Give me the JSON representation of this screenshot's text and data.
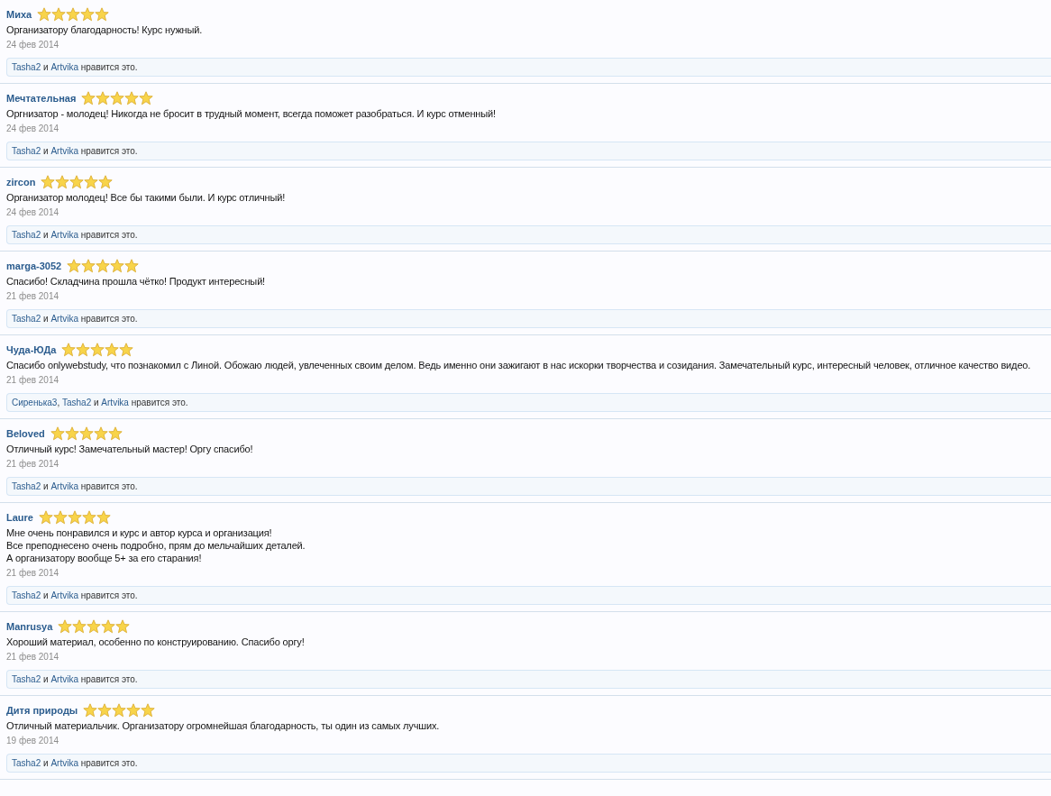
{
  "reviews": [
    {
      "author": "Миха",
      "stars": 5,
      "text": [
        "Организатору благодарность! Курс нужный."
      ],
      "date": "24 фев 2014",
      "likes": [
        {
          "kind": "link",
          "text": "Tasha2"
        },
        {
          "kind": "text",
          "text": " и "
        },
        {
          "kind": "link",
          "text": "Artvika"
        },
        {
          "kind": "text",
          "text": " нравится это."
        }
      ]
    },
    {
      "author": "Мечтательная",
      "stars": 5,
      "text": [
        "Оргнизатор - молодец! Никогда не бросит в трудный момент, всегда поможет разобраться. И курс отменный!"
      ],
      "date": "24 фев 2014",
      "likes": [
        {
          "kind": "link",
          "text": "Tasha2"
        },
        {
          "kind": "text",
          "text": " и "
        },
        {
          "kind": "link",
          "text": "Artvika"
        },
        {
          "kind": "text",
          "text": " нравится это."
        }
      ]
    },
    {
      "author": "zircon",
      "stars": 5,
      "text": [
        "Организатор молодец! Все бы такими были. И курс отличный!"
      ],
      "date": "24 фев 2014",
      "likes": [
        {
          "kind": "link",
          "text": "Tasha2"
        },
        {
          "kind": "text",
          "text": " и "
        },
        {
          "kind": "link",
          "text": "Artvika"
        },
        {
          "kind": "text",
          "text": " нравится это."
        }
      ]
    },
    {
      "author": "marga-3052",
      "stars": 5,
      "text": [
        "Спасибо! Складчина прошла чётко! Продукт интересный!"
      ],
      "date": "21 фев 2014",
      "likes": [
        {
          "kind": "link",
          "text": "Tasha2"
        },
        {
          "kind": "text",
          "text": " и "
        },
        {
          "kind": "link",
          "text": "Artvika"
        },
        {
          "kind": "text",
          "text": " нравится это."
        }
      ]
    },
    {
      "author": "Чуда-ЮДа",
      "stars": 5,
      "text": [
        "Спасибо onlywebstudy, что познакомил с Линой. Обожаю людей, увлеченных своим делом. Ведь именно они зажигают в нас искорки творчества и созидания. Замечательный курс, интересный человек, отличное качество видео."
      ],
      "date": "21 фев 2014",
      "likes": [
        {
          "kind": "link",
          "text": "Сиренька3"
        },
        {
          "kind": "text",
          "text": ", "
        },
        {
          "kind": "link",
          "text": "Tasha2"
        },
        {
          "kind": "text",
          "text": " и "
        },
        {
          "kind": "link",
          "text": "Artvika"
        },
        {
          "kind": "text",
          "text": " нравится это."
        }
      ]
    },
    {
      "author": "Beloved",
      "stars": 5,
      "text": [
        "Отличный курс! Замечательный мастер! Оргу спасибо!"
      ],
      "date": "21 фев 2014",
      "likes": [
        {
          "kind": "link",
          "text": "Tasha2"
        },
        {
          "kind": "text",
          "text": " и "
        },
        {
          "kind": "link",
          "text": "Artvika"
        },
        {
          "kind": "text",
          "text": " нравится это."
        }
      ]
    },
    {
      "author": "Laure",
      "stars": 5,
      "text": [
        "Мне очень понравился и курс и автор курса и организация!",
        "Все преподнесено очень подробно, прям до мельчайших деталей.",
        "А организатору вообще 5+ за его старания!"
      ],
      "date": "21 фев 2014",
      "likes": [
        {
          "kind": "link",
          "text": "Tasha2"
        },
        {
          "kind": "text",
          "text": " и "
        },
        {
          "kind": "link",
          "text": "Artvika"
        },
        {
          "kind": "text",
          "text": " нравится это."
        }
      ]
    },
    {
      "author": "Manrusya",
      "stars": 5,
      "text": [
        "Хороший материал, особенно по конструированию. Спасибо оргу!"
      ],
      "date": "21 фев 2014",
      "likes": [
        {
          "kind": "link",
          "text": "Tasha2"
        },
        {
          "kind": "text",
          "text": " и "
        },
        {
          "kind": "link",
          "text": "Artvika"
        },
        {
          "kind": "text",
          "text": " нравится это."
        }
      ]
    },
    {
      "author": "Дитя природы",
      "stars": 5,
      "text": [
        "Отличный материальчик. Организатору огромнейшая благодарность, ты один из самых лучших."
      ],
      "date": "19 фев 2014",
      "likes": [
        {
          "kind": "link",
          "text": "Tasha2"
        },
        {
          "kind": "text",
          "text": " и "
        },
        {
          "kind": "link",
          "text": "Artvika"
        },
        {
          "kind": "text",
          "text": " нравится это."
        }
      ]
    }
  ]
}
